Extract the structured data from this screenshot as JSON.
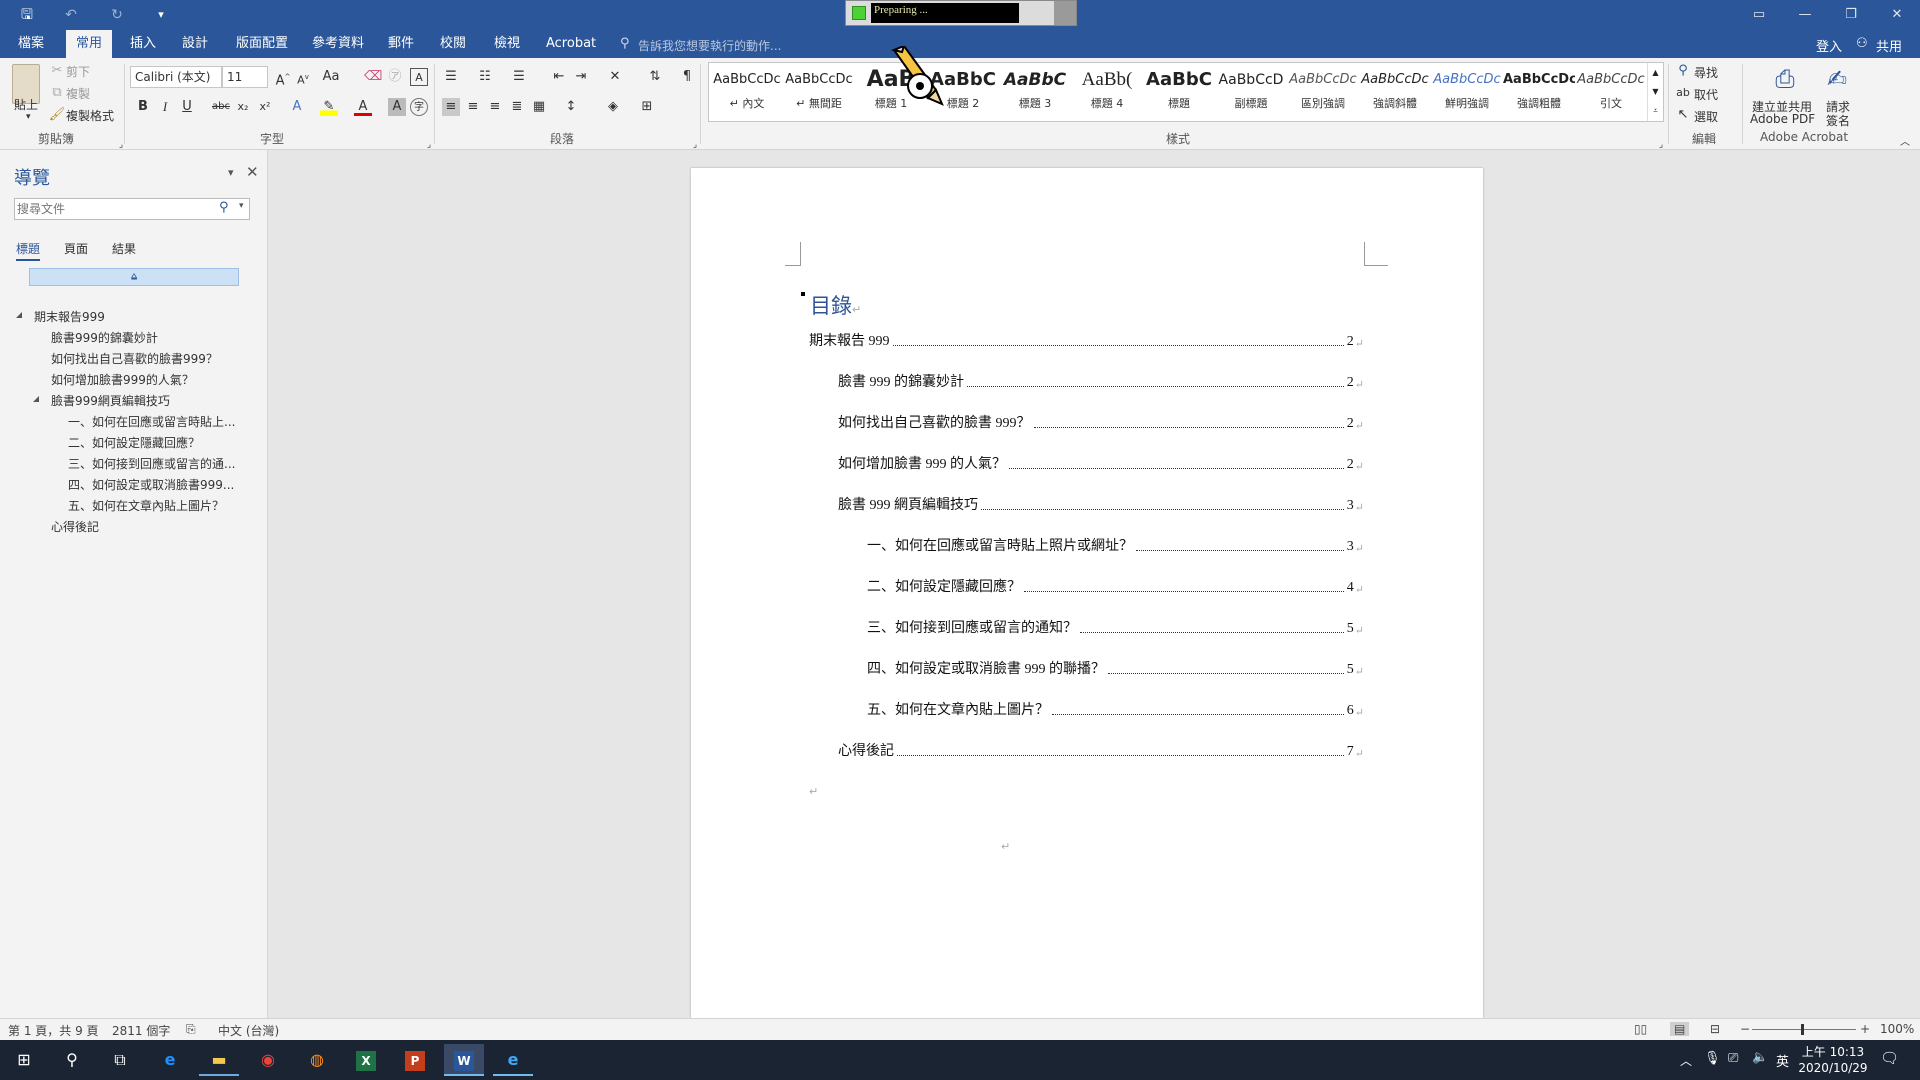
{
  "titlebar": {
    "qat": {
      "save": "🖫",
      "undo": "↶",
      "redo": "↻",
      "customize": "▾"
    },
    "progress_label": "Preparing ..."
  },
  "tabs": [
    "檔案",
    "常用",
    "插入",
    "設計",
    "版面配置",
    "參考資料",
    "郵件",
    "校閱",
    "檢視",
    "Acrobat"
  ],
  "tellme": "告訴我您想要執行的動作...",
  "account": {
    "signin": "登入",
    "share": "共用"
  },
  "clipboard": {
    "paste": "貼上",
    "cut": "剪下",
    "copy": "複製",
    "format_painter": "複製格式",
    "label": "剪貼簿"
  },
  "font": {
    "name": "Calibri (本文)",
    "size": "11",
    "label": "字型"
  },
  "paragraph": {
    "label": "段落"
  },
  "styles": {
    "label": "樣式",
    "items": [
      {
        "sample": "AaBbCcDc",
        "name": "↵ 內文"
      },
      {
        "sample": "AaBbCcDc",
        "name": "↵ 無間距"
      },
      {
        "sample": "AaB",
        "name": "標題 1"
      },
      {
        "sample": "AaBbC",
        "name": "標題 2"
      },
      {
        "sample": "AaBbC",
        "name": "標題 3"
      },
      {
        "sample": "AaBb(",
        "name": "標題 4"
      },
      {
        "sample": "AaBbC",
        "name": "標題"
      },
      {
        "sample": "AaBbCcD",
        "name": "副標題"
      },
      {
        "sample": "AaBbCcDc",
        "name": "區別強調"
      },
      {
        "sample": "AaBbCcDc",
        "name": "強調斜體"
      },
      {
        "sample": "AaBbCcDc",
        "name": "鮮明強調"
      },
      {
        "sample": "AaBbCcDc",
        "name": "強調粗體"
      },
      {
        "sample": "AaBbCcDc",
        "name": "引文"
      }
    ]
  },
  "editing": {
    "find": "尋找",
    "replace": "取代",
    "select": "選取",
    "label": "編輯"
  },
  "acrobat": {
    "create": "建立並共用",
    "create2": "Adobe PDF",
    "sign": "請求",
    "sign2": "簽名",
    "label": "Adobe Acrobat"
  },
  "nav": {
    "title": "導覽",
    "search_placeholder": "搜尋文件",
    "tabs": [
      "標題",
      "頁面",
      "結果"
    ],
    "items": [
      {
        "text": "期末報告999",
        "level": 0,
        "arrow": "◢"
      },
      {
        "text": "臉書999的錦囊妙計",
        "level": 1,
        "arrow": ""
      },
      {
        "text": "如何找出自己喜歡的臉書999？",
        "level": 1,
        "arrow": ""
      },
      {
        "text": "如何增加臉書999的人氣？",
        "level": 1,
        "arrow": ""
      },
      {
        "text": "臉書999網頁編輯技巧",
        "level": 1,
        "arrow": "◢"
      },
      {
        "text": "一、如何在回應或留言時貼上...",
        "level": 2,
        "arrow": ""
      },
      {
        "text": "二、如何設定隱藏回應？",
        "level": 2,
        "arrow": ""
      },
      {
        "text": "三、如何接到回應或留言的通...",
        "level": 2,
        "arrow": ""
      },
      {
        "text": "四、如何設定或取消臉書999...",
        "level": 2,
        "arrow": ""
      },
      {
        "text": "五、如何在文章內貼上圖片？",
        "level": 2,
        "arrow": ""
      },
      {
        "text": "心得後記",
        "level": 1,
        "arrow": ""
      }
    ]
  },
  "document": {
    "toc_title": "目錄",
    "entries": [
      {
        "text": "期末報告 999",
        "page": "2",
        "level": 0
      },
      {
        "text": "臉書 999 的錦囊妙計",
        "page": "2",
        "level": 1
      },
      {
        "text": "如何找出自己喜歡的臉書 999？",
        "page": "2",
        "level": 1
      },
      {
        "text": "如何增加臉書 999 的人氣？",
        "page": "2",
        "level": 1
      },
      {
        "text": "臉書 999 網頁編輯技巧",
        "page": "3",
        "level": 1
      },
      {
        "text": "一、如何在回應或留言時貼上照片或網址？",
        "page": "3",
        "level": 2
      },
      {
        "text": "二、如何設定隱藏回應？",
        "page": "4",
        "level": 2
      },
      {
        "text": "三、如何接到回應或留言的通知？",
        "page": "5",
        "level": 2
      },
      {
        "text": "四、如何設定或取消臉書 999 的聯播？",
        "page": "5",
        "level": 2
      },
      {
        "text": "五、如何在文章內貼上圖片？",
        "page": "6",
        "level": 2
      },
      {
        "text": "心得後記",
        "page": "7",
        "level": 1
      }
    ],
    "return_mark": "↵"
  },
  "status": {
    "page": "第 1 頁，共 9 頁",
    "words": "2811 個字",
    "language": "中文 (台灣)",
    "zoom": "100%"
  },
  "taskbar": {
    "ime": "英",
    "time": "上午 10:13",
    "date": "2020/10/29"
  },
  "colors": {
    "brand": "#2b579a",
    "heading": "#2f5496",
    "taskbar": "#1b2433"
  }
}
